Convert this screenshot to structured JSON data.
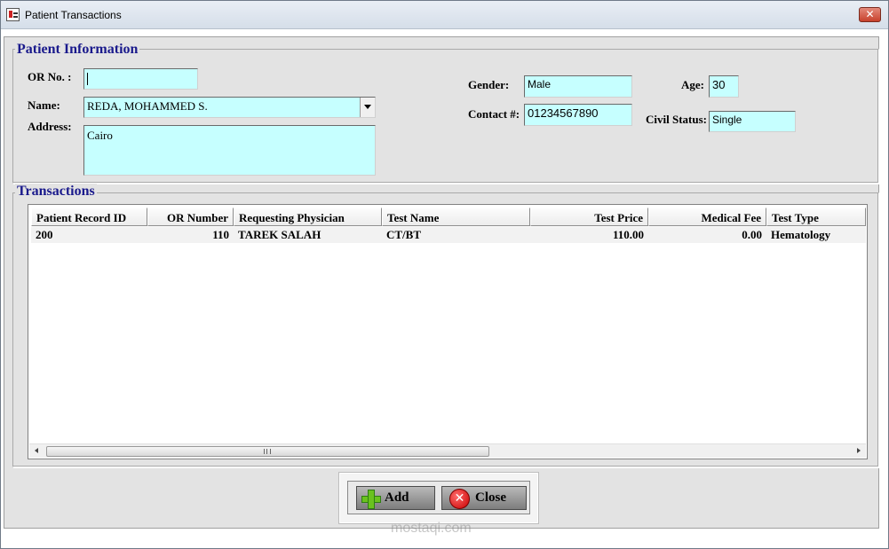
{
  "window": {
    "title": "Patient Transactions",
    "close_glyph": "✕"
  },
  "patient_info": {
    "title": "Patient Information",
    "or_no": {
      "label": "OR No. :",
      "value": ""
    },
    "name": {
      "label": "Name:",
      "value": "REDA, MOHAMMED S."
    },
    "address": {
      "label": "Address:",
      "value": "Cairo"
    },
    "gender": {
      "label": "Gender:",
      "value": "Male"
    },
    "contact": {
      "label": "Contact #:",
      "value": "01234567890"
    },
    "age": {
      "label": "Age:",
      "value": "30"
    },
    "civil_status": {
      "label": "Civil Status:",
      "value": "Single"
    }
  },
  "transactions": {
    "title": "Transactions",
    "columns": [
      "Patient Record ID",
      "OR Number",
      "Requesting Physician",
      "Test Name",
      "Test Price",
      "Medical Fee",
      "Test Type"
    ],
    "rows": [
      [
        "200",
        "110",
        "TAREK SALAH",
        "CT/BT",
        "110.00",
        "0.00",
        "Hematology"
      ]
    ]
  },
  "buttons": {
    "add_label": "Add",
    "close_label": "Close"
  },
  "watermark": "mostaqi.com",
  "colors": {
    "field_bg": "#c6ffff",
    "group_title": "#1a1a8c",
    "add_icon": "#6ac21f",
    "close_icon": "#c80000"
  },
  "icons": {
    "app": "app-icon",
    "add": "plus-icon",
    "close": "close-circle-icon",
    "dropdown": "chevron-down-icon"
  }
}
